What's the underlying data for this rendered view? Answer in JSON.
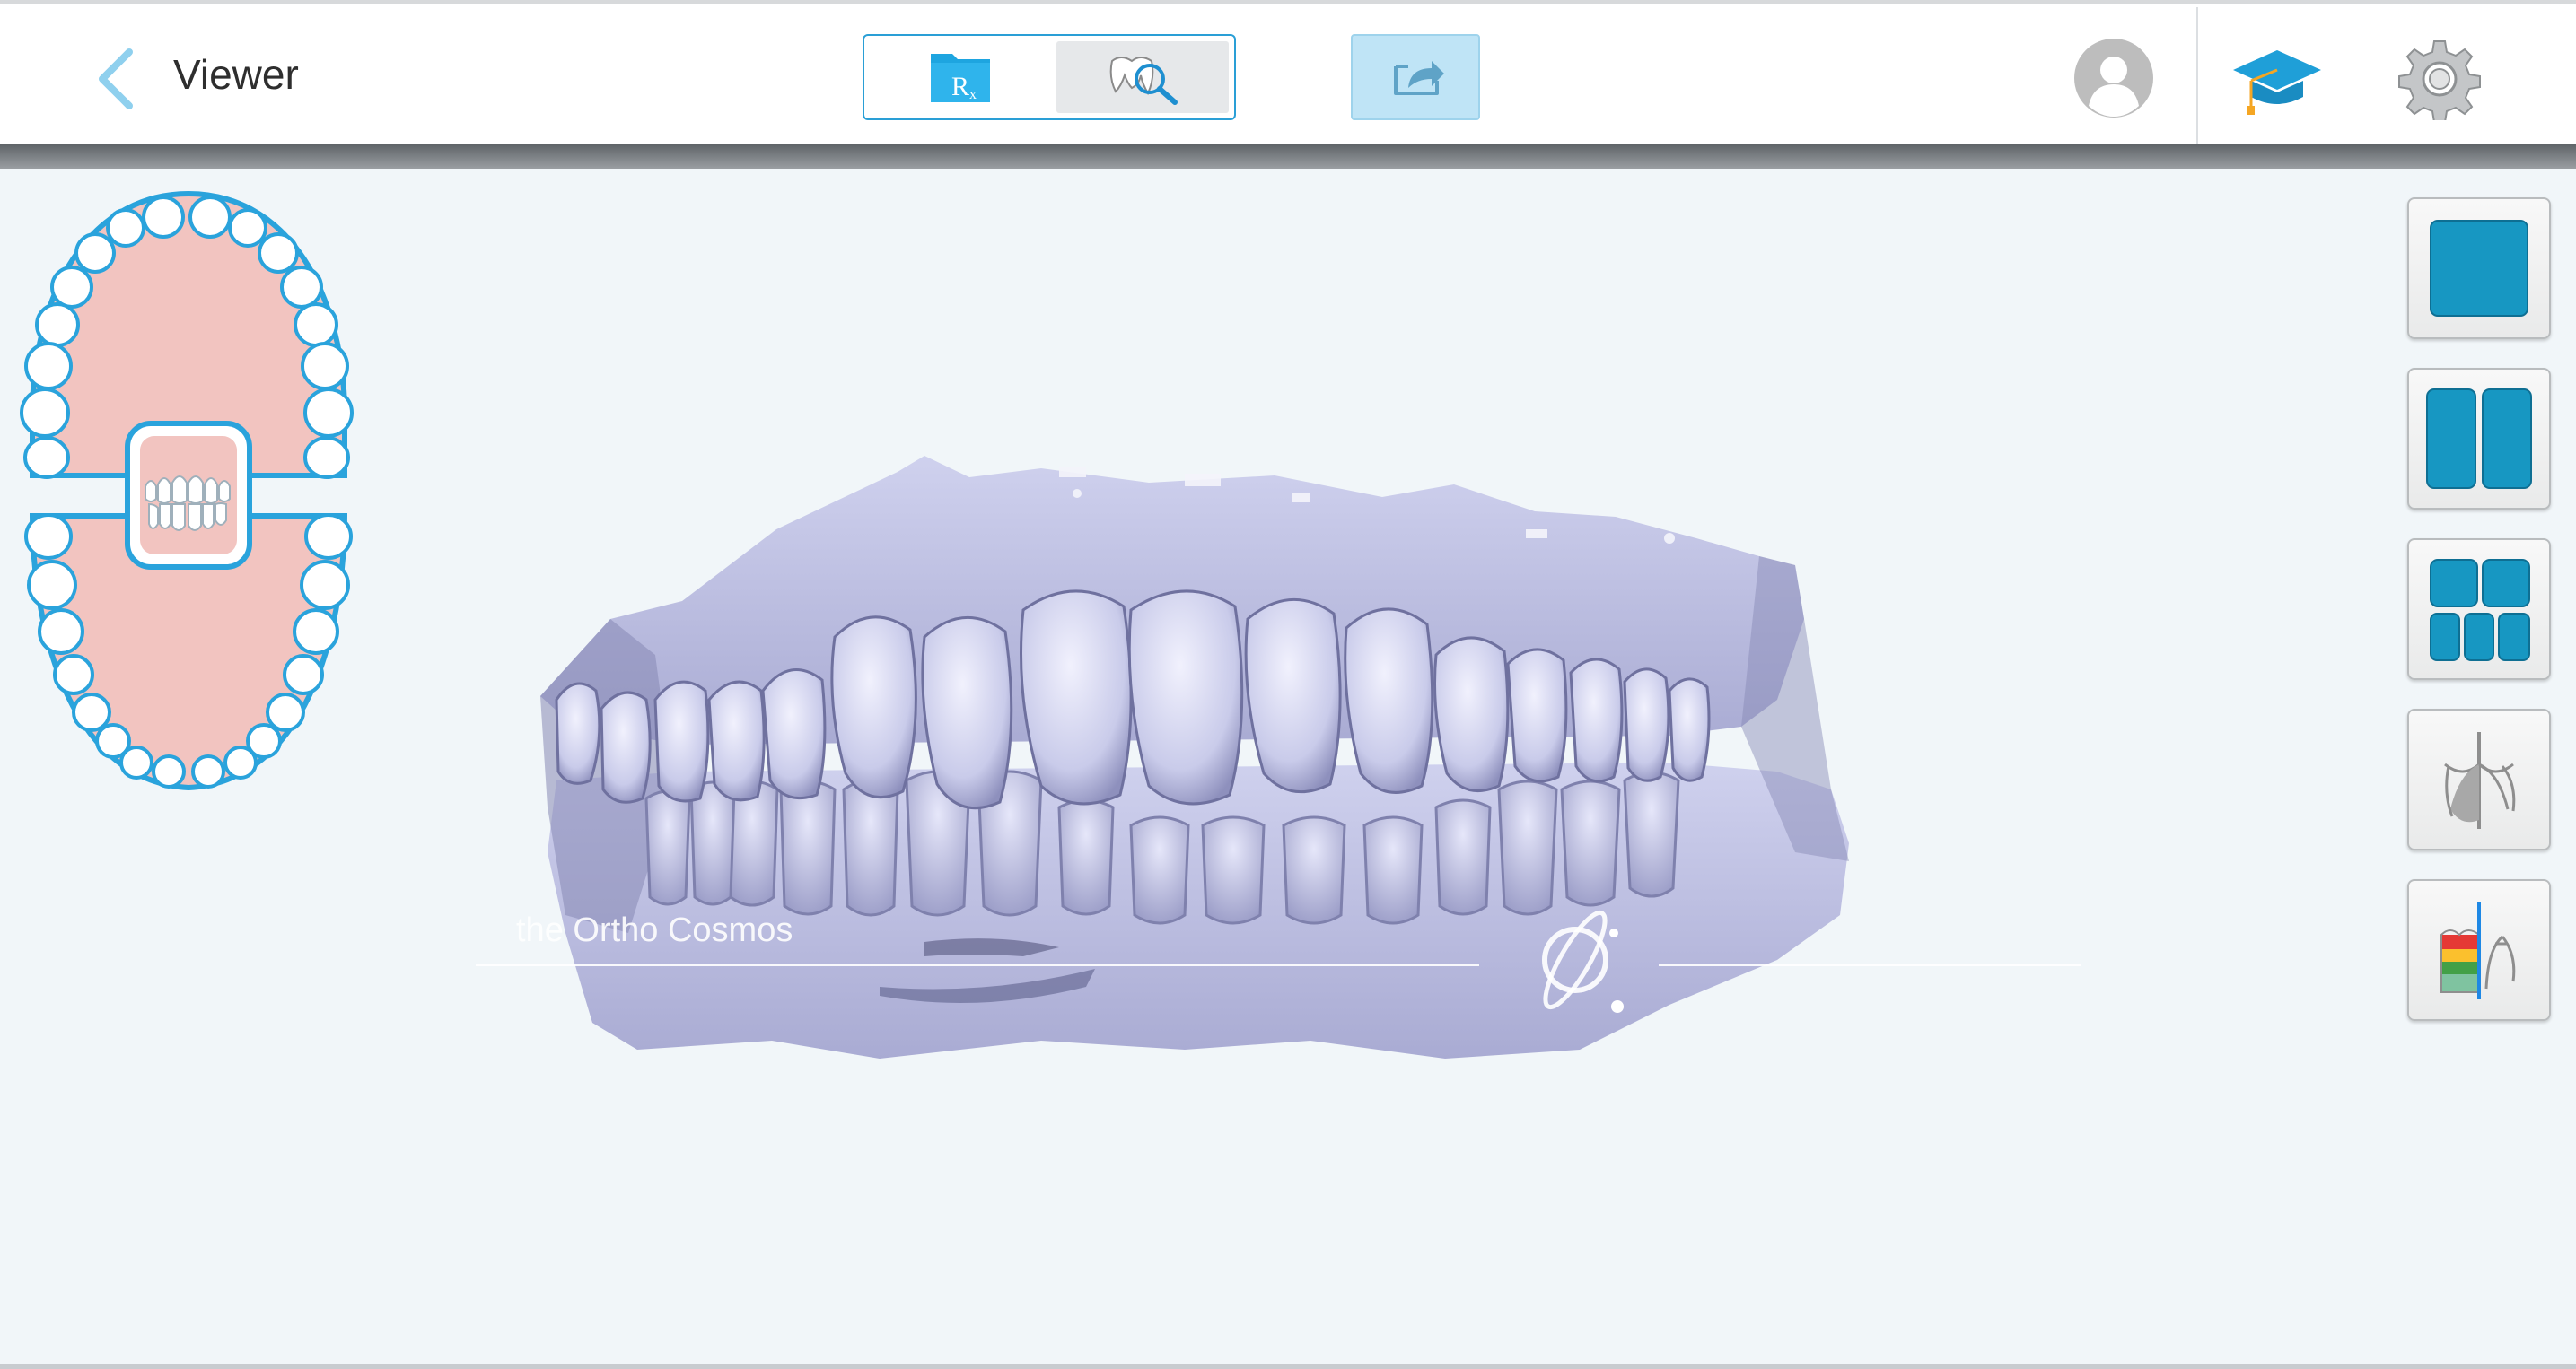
{
  "header": {
    "title": "Viewer"
  },
  "watermark": {
    "text": "the Ortho Cosmos"
  },
  "colors": {
    "accent": "#2a9fd6",
    "layout_tile": "#1797c2",
    "gum": "#f2c4c0",
    "model": "#c4c6e6"
  }
}
